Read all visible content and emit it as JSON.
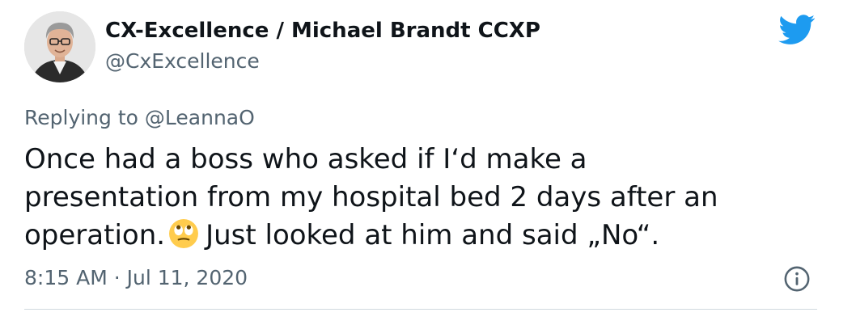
{
  "author": {
    "display_name": "CX-Excellence / Michael Brandt CCXP",
    "handle": "@CxExcellence"
  },
  "reply": {
    "prefix": "Replying to",
    "mention": "@LeannaO"
  },
  "tweet": {
    "line1": "Once had a boss who asked if I‘d make a",
    "line2": "presentation from my hospital bed 2 days after an",
    "line3_before_emoji": "operation.",
    "line3_after_emoji": "Just looked at him and said „No“.",
    "emoji": "rolling-eyes-emoji"
  },
  "meta": {
    "timestamp": "8:15 AM · Jul 11, 2020"
  },
  "icons": {
    "brand": "twitter-bird-icon",
    "info": "info-icon"
  },
  "colors": {
    "twitter_blue": "#1d9bf0",
    "secondary_text": "#536471",
    "primary_text": "#0f1419"
  }
}
